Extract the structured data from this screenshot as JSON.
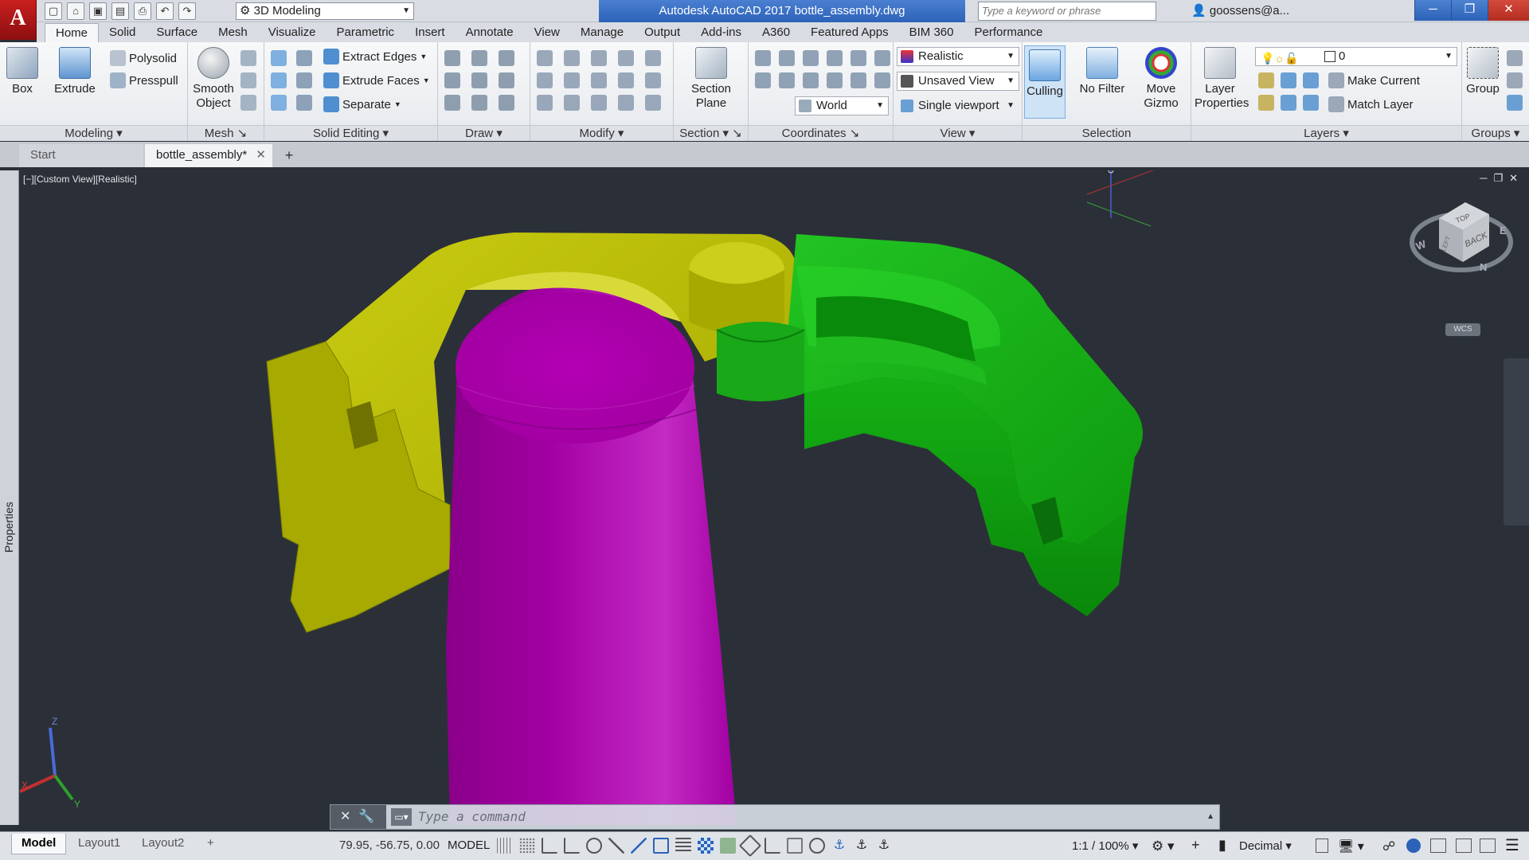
{
  "app": {
    "logo_letter": "A",
    "window_title": "Autodesk AutoCAD 2017    bottle_assembly.dwg",
    "workspace": "3D Modeling",
    "search_placeholder": "Type a keyword or phrase",
    "user": "goossens@a..."
  },
  "ribbon_tabs": [
    "Home",
    "Solid",
    "Surface",
    "Mesh",
    "Visualize",
    "Parametric",
    "Insert",
    "Annotate",
    "View",
    "Manage",
    "Output",
    "Add-ins",
    "A360",
    "Featured Apps",
    "BIM 360",
    "Performance"
  ],
  "ribbon": {
    "modeling": {
      "title": "Modeling",
      "box": "Box",
      "extrude": "Extrude",
      "polysolid": "Polysolid",
      "presspull": "Presspull"
    },
    "mesh": {
      "title": "Mesh",
      "smooth": "Smooth",
      "object": "Object"
    },
    "solid_editing": {
      "title": "Solid Editing",
      "extract_edges": "Extract Edges",
      "extrude_faces": "Extrude Faces",
      "separate": "Separate"
    },
    "draw": {
      "title": "Draw"
    },
    "modify": {
      "title": "Modify"
    },
    "section": {
      "title": "Section",
      "section": "Section",
      "plane": "Plane"
    },
    "coordinates": {
      "title": "Coordinates",
      "ucs": "World"
    },
    "view": {
      "title": "View",
      "visual_style": "Realistic",
      "named_view": "Unsaved View",
      "viewport": "Single viewport"
    },
    "selection": {
      "title": "Selection",
      "culling": "Culling",
      "no_filter": "No Filter",
      "move": "Move",
      "gizmo": "Gizmo"
    },
    "layers": {
      "title": "Layers",
      "layer": "Layer",
      "properties": "Properties",
      "current_layer": "0",
      "make_current": "Make Current",
      "match_layer": "Match Layer"
    },
    "groups": {
      "title": "Groups",
      "group": "Group"
    }
  },
  "doc_tabs": {
    "start": "Start",
    "active": "bottle_assembly*"
  },
  "viewport": {
    "label": "[−][Custom View][Realistic]",
    "properties_palette": "Properties",
    "viewcube_face": "BACK",
    "viewcube_top": "TOP",
    "viewcube_left": "LEFT",
    "compass_w": "W",
    "compass_n": "N",
    "compass_e": "E",
    "wcs_label": "WCS",
    "ucs_z": "Z",
    "ucs_y": "Y",
    "ucs_x": "X"
  },
  "command_line": {
    "placeholder": "Type a command"
  },
  "status_bar": {
    "layout_tabs": [
      "Model",
      "Layout1",
      "Layout2"
    ],
    "coordinates": "79.95, -56.75, 0.00",
    "mode": "MODEL",
    "annotation_scale": "1:1 / 100%",
    "units": "Decimal"
  },
  "colors": {
    "cap_yellow": "#b5b800",
    "cap_green": "#18b018",
    "bottle_magenta": "#b800b8",
    "viewport_bg": "#2b3038",
    "title_accent": "#2c62b8"
  }
}
